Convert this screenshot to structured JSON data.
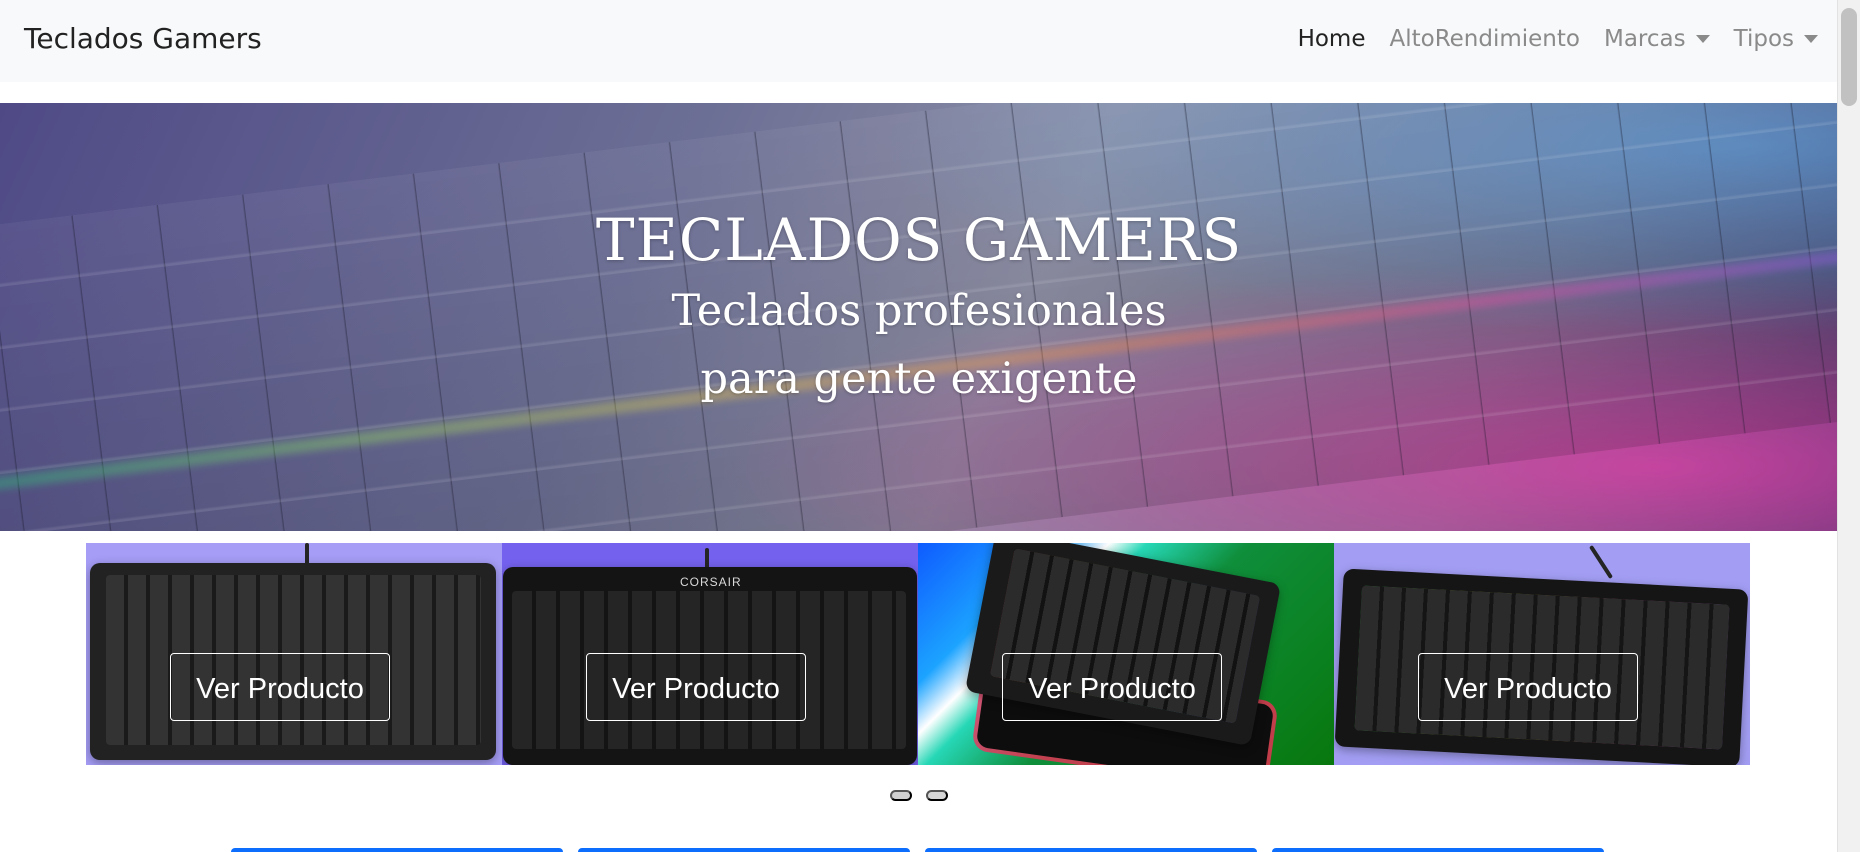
{
  "navbar": {
    "brand": "Teclados Gamers",
    "items": [
      {
        "label": "Home",
        "active": true,
        "dropdown": false
      },
      {
        "label": "AltoRendimiento",
        "active": false,
        "dropdown": false
      },
      {
        "label": "Marcas",
        "active": false,
        "dropdown": true
      },
      {
        "label": "Tipos",
        "active": false,
        "dropdown": true
      }
    ]
  },
  "hero": {
    "title": "TECLADOS GAMERS",
    "subtitle_line_1": "Teclados profesionales",
    "subtitle_line_2": "para gente exigente"
  },
  "products": [
    {
      "button_label": "Ver Producto",
      "image_type": "keyboard-red-rgb"
    },
    {
      "button_label": "Ver Producto",
      "image_type": "keyboard-corsair-red"
    },
    {
      "button_label": "Ver Producto",
      "image_type": "keyboard-rgb-mousepad"
    },
    {
      "button_label": "Ver Producto",
      "image_type": "keyboard-rgb-silver"
    }
  ],
  "product_brand_text": "CORSAIR",
  "carousel": {
    "indicator_count": 2,
    "active_index": 0
  },
  "colors": {
    "navbar_bg": "#f8f9fa",
    "primary": "#0d6efd",
    "text": "#222222",
    "muted_nav": "#8a8a8a"
  },
  "icons": {
    "dropdown": "chevron-down-icon"
  }
}
